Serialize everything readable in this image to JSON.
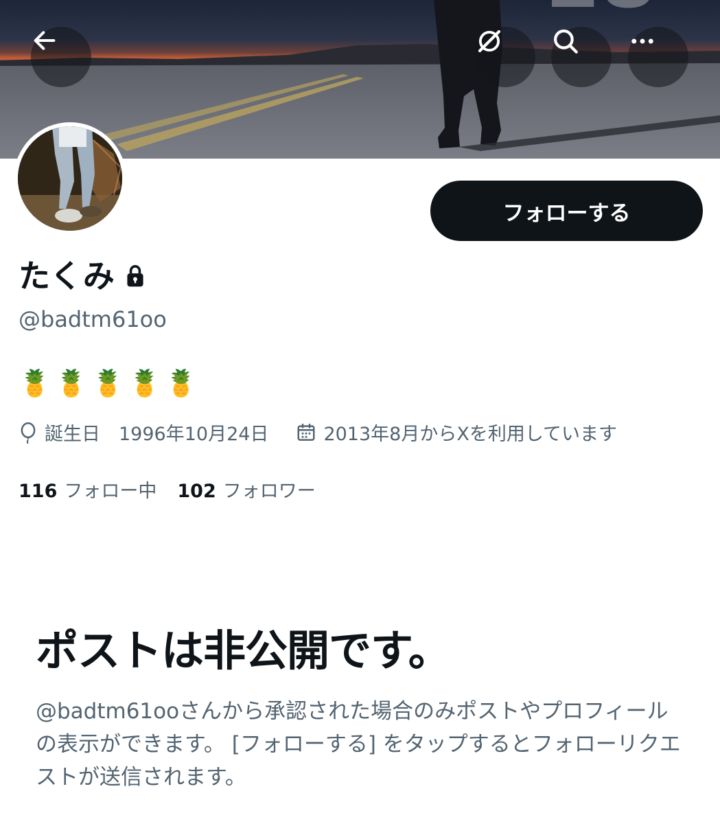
{
  "header": {
    "back_icon": "arrow-left-icon",
    "grok_icon": "grok-icon",
    "search_icon": "search-icon",
    "more_icon": "more-horizontal-icon"
  },
  "profile": {
    "display_name": "たくみ",
    "lock_icon": "lock-icon",
    "handle": "@badtm61oo",
    "bio": "🍍🍍🍍🍍🍍",
    "birthday": "誕生日　1996年10月24日",
    "joined": "2013年8月からXを利用しています",
    "following_count": "116",
    "following_label": "フォロー中",
    "followers_count": "102",
    "followers_label": "フォロワー"
  },
  "actions": {
    "follow_label": "フォローする"
  },
  "private_notice": {
    "title": "ポストは非公開です。",
    "description": "@badtm61ooさんから承認された場合のみポストやプロフィールの表示ができます。 [フォローする] をタップするとフォローリクエストが送信されます。"
  },
  "colors": {
    "primary_text": "#0f1419",
    "secondary_text": "#536471",
    "button_bg": "#0f1419"
  }
}
